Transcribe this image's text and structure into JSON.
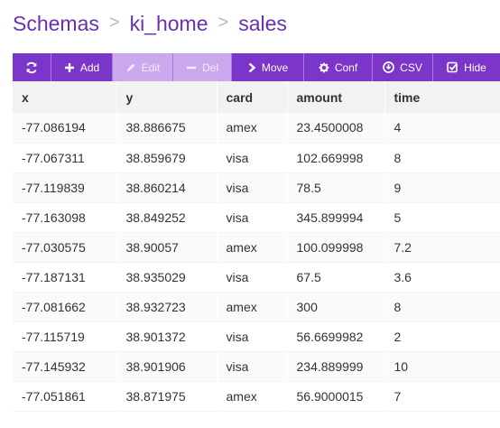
{
  "breadcrumb": {
    "items": [
      "Schemas",
      "ki_home",
      "sales"
    ],
    "separator": ">"
  },
  "toolbar": {
    "buttons": [
      {
        "icon": "refresh-icon",
        "label": "",
        "enabled": true
      },
      {
        "icon": "plus-icon",
        "label": "Add",
        "enabled": true
      },
      {
        "icon": "pencil-icon",
        "label": "Edit",
        "enabled": false
      },
      {
        "icon": "minus-icon",
        "label": "Del",
        "enabled": false
      },
      {
        "icon": "chevron-right-icon",
        "label": "Move",
        "enabled": true
      },
      {
        "icon": "gear-icon",
        "label": "Conf",
        "enabled": true
      },
      {
        "icon": "download-circle-icon",
        "label": "CSV",
        "enabled": true
      },
      {
        "icon": "checkbox-icon",
        "label": "Hide",
        "enabled": true
      }
    ]
  },
  "table": {
    "columns": [
      "x",
      "y",
      "card",
      "amount",
      "time"
    ],
    "rows": [
      [
        "-77.086194",
        "38.886675",
        "amex",
        "23.4500008",
        "4"
      ],
      [
        "-77.067311",
        "38.859679",
        "visa",
        "102.669998",
        "8"
      ],
      [
        "-77.119839",
        "38.860214",
        "visa",
        "78.5",
        "9"
      ],
      [
        "-77.163098",
        "38.849252",
        "visa",
        "345.899994",
        "5"
      ],
      [
        "-77.030575",
        "38.90057",
        "amex",
        "100.099998",
        "7.2"
      ],
      [
        "-77.187131",
        "38.935029",
        "visa",
        "67.5",
        "3.6"
      ],
      [
        "-77.081662",
        "38.932723",
        "amex",
        "300",
        "8"
      ],
      [
        "-77.115719",
        "38.901372",
        "visa",
        "56.6699982",
        "2"
      ],
      [
        "-77.145932",
        "38.901906",
        "visa",
        "234.889999",
        "10"
      ],
      [
        "-77.051861",
        "38.871975",
        "amex",
        "56.9000015",
        "7"
      ]
    ]
  },
  "colors": {
    "accent": "#7b35c8",
    "accent_disabled": "#c9a9eb",
    "breadcrumb_text": "#6a2fb3"
  }
}
